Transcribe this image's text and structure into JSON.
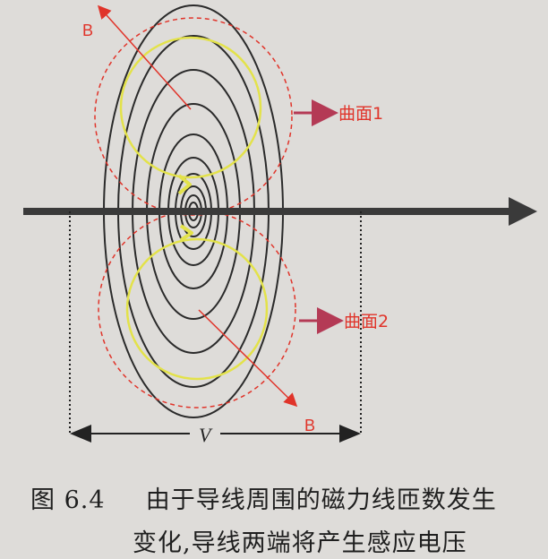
{
  "diagram": {
    "label_b_top": "B",
    "label_b_bottom": "B",
    "label_surface_1": "曲面1",
    "label_surface_2": "曲面2",
    "label_v": "V",
    "colors": {
      "field_lines": "#2a2a2a",
      "wire": "#3a3a3a",
      "dashed_circles": "#e0342a",
      "yellow_circles": "#e3e24a",
      "b_arrows": "#e0342a",
      "pointer": "#b43a55",
      "label_text": "#e0342a",
      "dimension": "#222222"
    }
  },
  "caption": {
    "number": "图 6.4",
    "line1": "由于导线周围的磁力线匝数发生",
    "line2": "变化,导线两端将产生感应电压"
  }
}
